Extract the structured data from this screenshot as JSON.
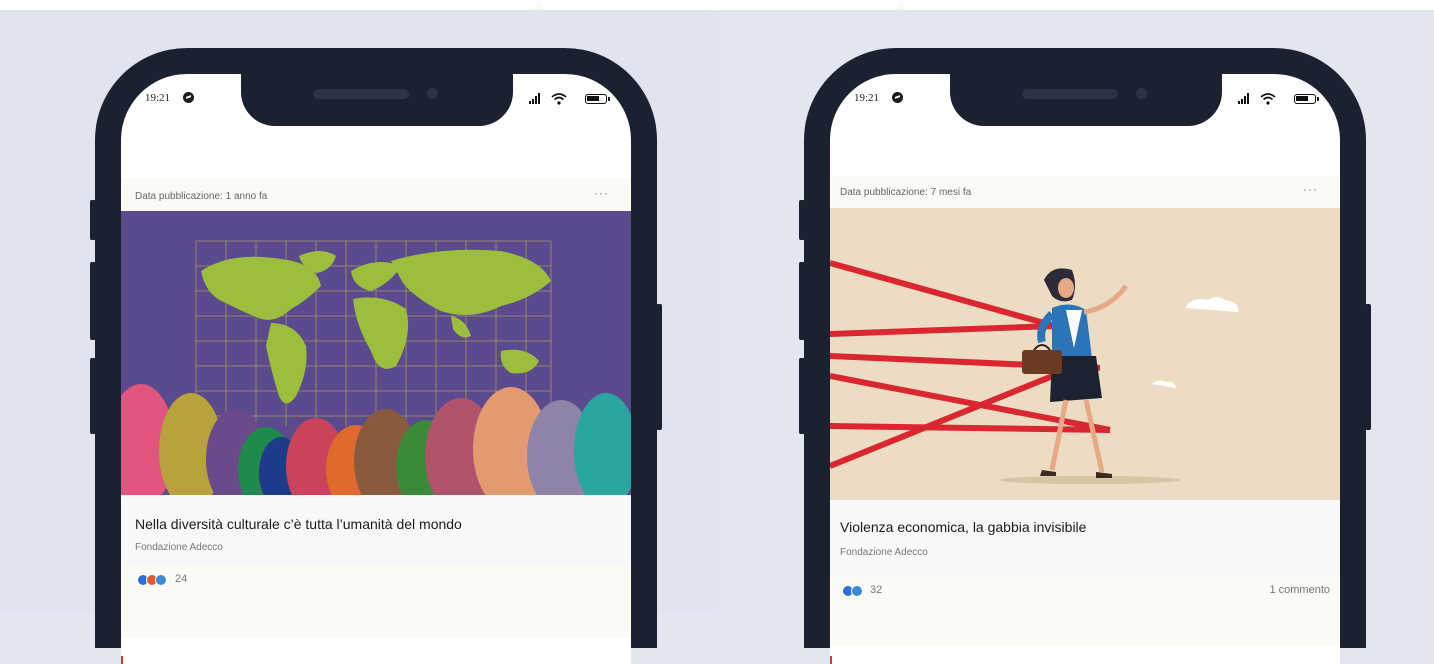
{
  "status_bar": {
    "time": "19:21"
  },
  "posts": [
    {
      "publish_date": "Data pubblicazione: 1 anno fa",
      "more": "···",
      "title": "Nella diversità culturale c’è tutta l’umanità del mondo",
      "source": "Fondazione Adecco",
      "reaction_count": "24",
      "comments": ""
    },
    {
      "publish_date": "Data pubblicazione: 7 mesi fa",
      "more": "···",
      "title": "Violenza economica, la gabbia invisibile",
      "source": "Fondazione Adecco",
      "reaction_count": "32",
      "comments": "1 commento"
    }
  ],
  "colors": {
    "phone_frame": "#1c2130",
    "page_background": "#e3e6ef",
    "image1_background": "#5c4a8e",
    "image2_background": "#ecdcc4",
    "accent_red": "#d23a3a"
  }
}
